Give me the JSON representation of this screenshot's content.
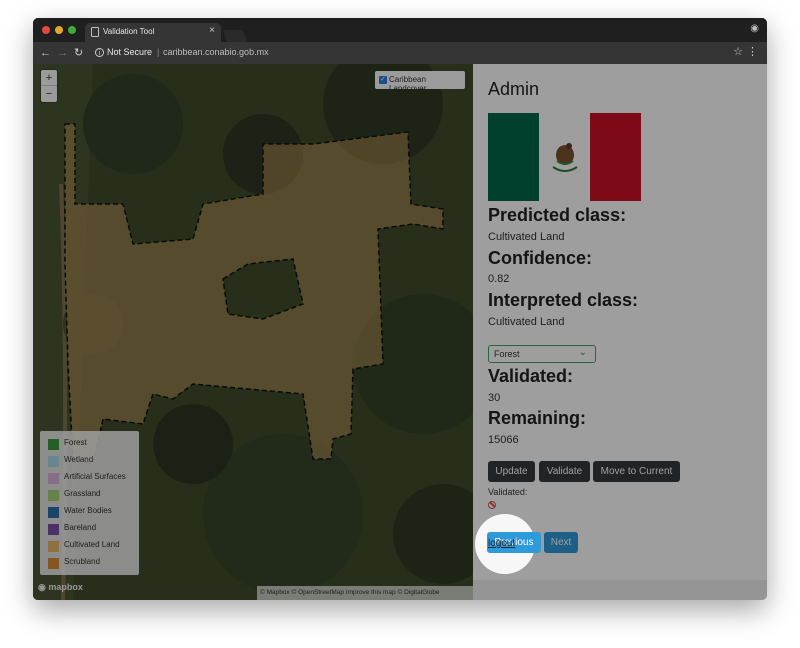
{
  "browser": {
    "tab_title": "Validation Tool",
    "tab_close": "×",
    "security_label": "Not Secure",
    "separator": "|",
    "url": "caribbean.conabio.gob.mx"
  },
  "map": {
    "zoom_in": "+",
    "zoom_out": "−",
    "layer_label": "Caribbean Landcover",
    "layer_checked": true,
    "legend": [
      {
        "label": "Forest",
        "color": "#3a9a3a"
      },
      {
        "label": "Wetland",
        "color": "#a6d8e8"
      },
      {
        "label": "Artificial Surfaces",
        "color": "#d9b3d9"
      },
      {
        "label": "Grassland",
        "color": "#a5d27a"
      },
      {
        "label": "Water Bodies",
        "color": "#2b6fa8"
      },
      {
        "label": "Bareland",
        "color": "#7a4fa3"
      },
      {
        "label": "Cultivated Land",
        "color": "#e8b36a"
      },
      {
        "label": "Scrubland",
        "color": "#d98a3a"
      }
    ],
    "brand": "mapbox",
    "attribution": "© Mapbox © OpenStreetMap Improve this map © DigitalGlobe"
  },
  "panel": {
    "title": "Admin",
    "predicted_label": "Predicted class:",
    "predicted_value": "Cultivated Land",
    "confidence_label": "Confidence:",
    "confidence_value": "0.82",
    "interpreted_label": "Interpreted class:",
    "interpreted_value": "Cultivated Land",
    "select_value": "Forest",
    "validated_label": "Validated:",
    "validated_value": "30",
    "remaining_label": "Remaining:",
    "remaining_value": "15066",
    "update_button": "Update",
    "validate_button": "Validate",
    "move_button": "Move to Current",
    "validated_small_label": "Validated:",
    "previous_button": "Previous",
    "next_button": "Next",
    "logout_link": "logout"
  },
  "colors": {
    "flag_green": "#006847",
    "flag_white": "#ffffff",
    "flag_red": "#ce1126",
    "button_dark": "#343a40",
    "button_blue": "#2f9ad9",
    "polygon_fill": "#e8b36a"
  }
}
